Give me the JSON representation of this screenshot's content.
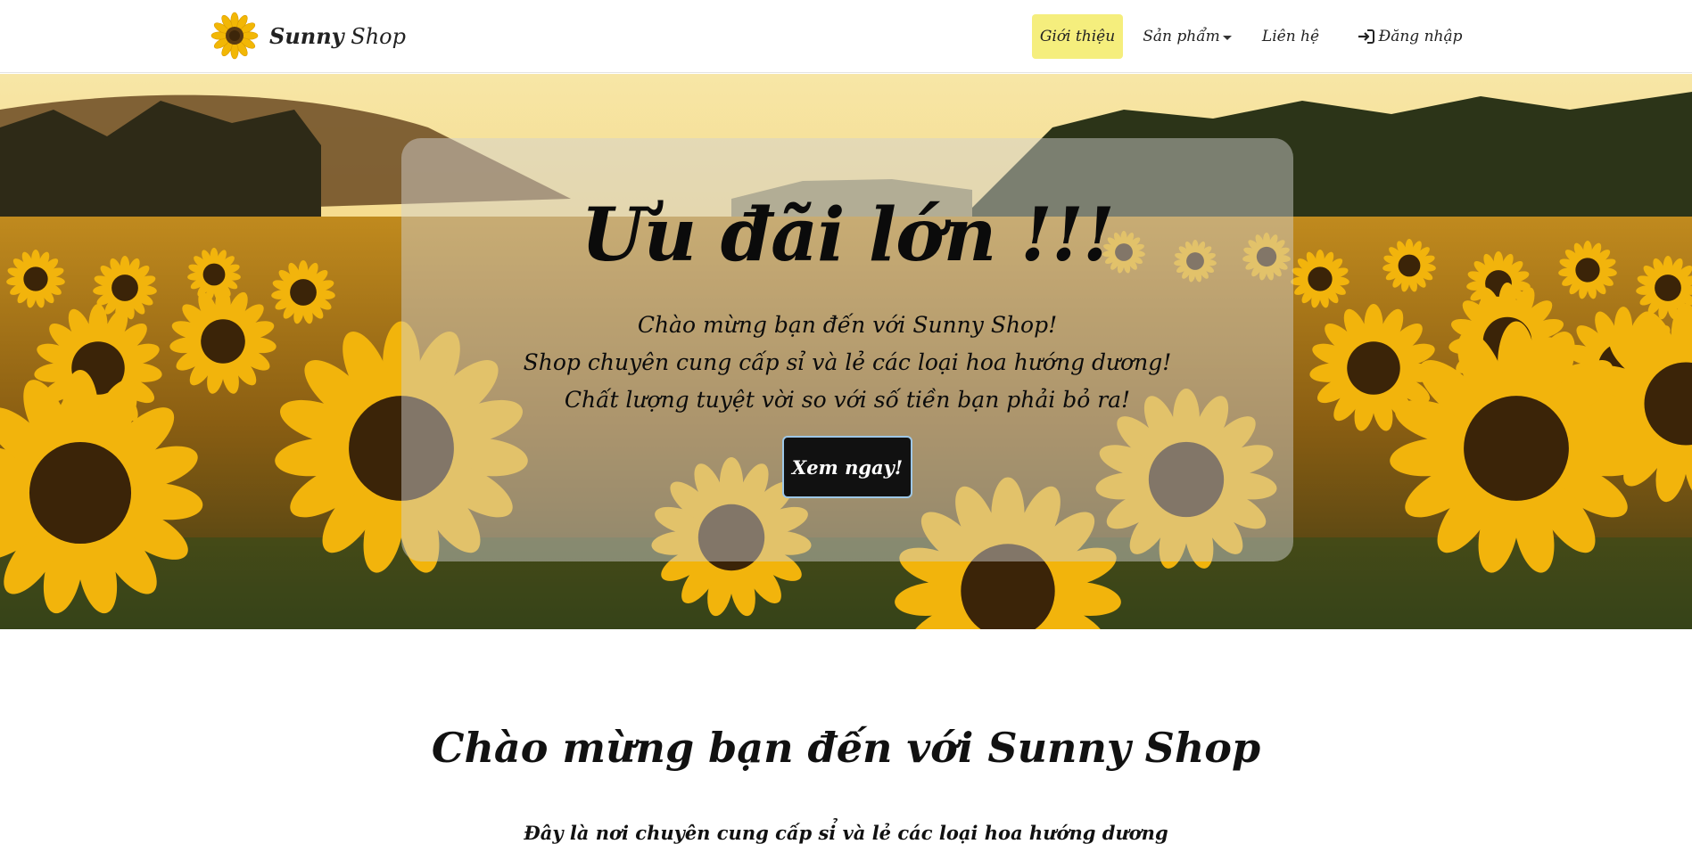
{
  "navbar": {
    "brand_bold": "Sunny",
    "brand_rest": " Shop",
    "logo_icon": "sunflower-icon",
    "items": [
      {
        "label": "Giới thiệu",
        "active": true
      },
      {
        "label": "Sản phẩm",
        "has_dropdown": true
      },
      {
        "label": "Liên hệ"
      },
      {
        "label": "Đăng nhập",
        "icon": "sign-in-icon"
      }
    ],
    "active_color": "#f5ee7d"
  },
  "hero": {
    "title": "Ưu đãi lớn !!!",
    "lines": [
      "Chào mừng bạn đến với Sunny Shop!",
      "Shop chuyên cung cấp sỉ và lẻ các loại hoa hướng dương!",
      "Chất lượng tuyệt vời so với số tiền bạn phải bỏ ra!"
    ],
    "button_label": "Xem ngay!",
    "background_image": "sunflower-field"
  },
  "welcome": {
    "title": "Chào mừng bạn đến với Sunny Shop",
    "subtitle": "Đây là nơi chuyên cung cấp sỉ và lẻ các loại hoa hướng dương"
  }
}
